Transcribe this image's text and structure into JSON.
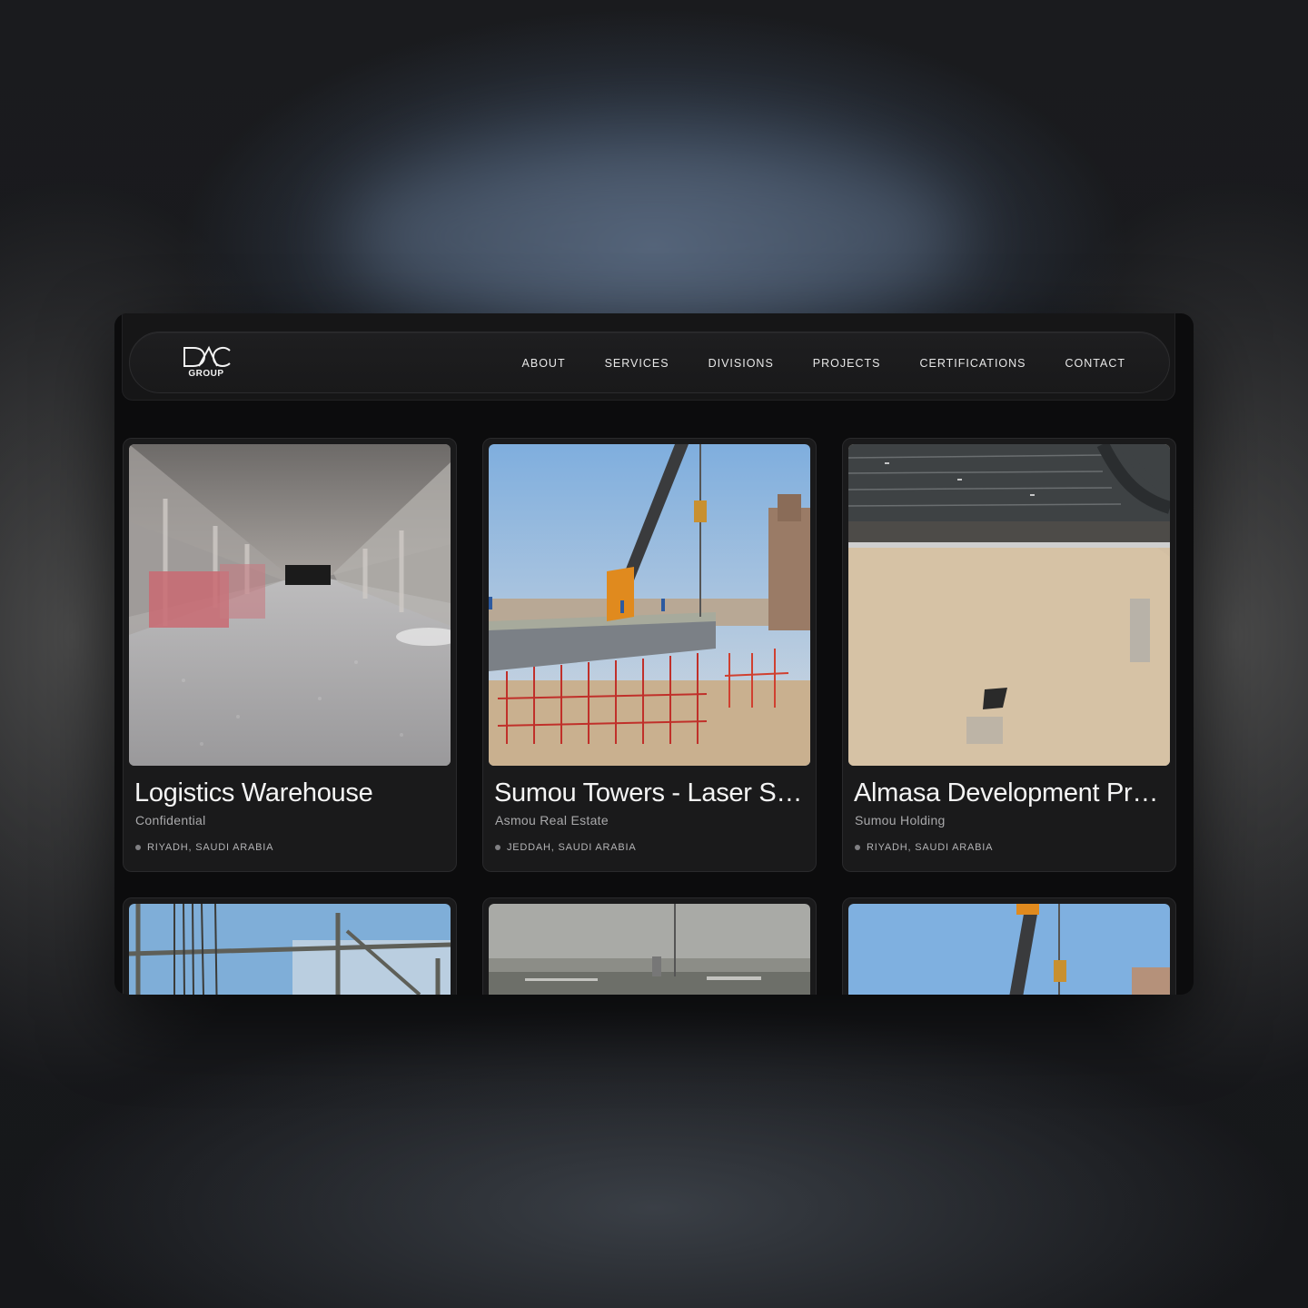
{
  "brand": {
    "logo_mark": "DAC",
    "logo_sub": "GROUP"
  },
  "nav": {
    "items": [
      {
        "label": "ABOUT"
      },
      {
        "label": "SERVICES"
      },
      {
        "label": "DIVISIONS"
      },
      {
        "label": "PROJECTS"
      },
      {
        "label": "CERTIFICATIONS"
      },
      {
        "label": "CONTACT"
      }
    ]
  },
  "projects": [
    {
      "title": "Logistics Warehouse",
      "client": "Confidential",
      "location": "RIYADH, SAUDI ARABIA",
      "image": "warehouse-interior-scan"
    },
    {
      "title": "Sumou Towers - Laser Scanning",
      "client": "Asmou Real Estate",
      "location": "JEDDAH, SAUDI ARABIA",
      "image": "bridge-crane-construction"
    },
    {
      "title": "Almasa Development Project",
      "client": "Sumou Holding",
      "location": "RIYADH, SAUDI ARABIA",
      "image": "aerial-desert-site"
    },
    {
      "image": "scaffolding-sky"
    },
    {
      "image": "city-skyline-haze"
    },
    {
      "image": "crane-sky"
    }
  ],
  "colors": {
    "background": "#0c0c0d",
    "card": "#1a1a1b",
    "text": "#f4f4f4",
    "muted": "#a9a9ab"
  }
}
